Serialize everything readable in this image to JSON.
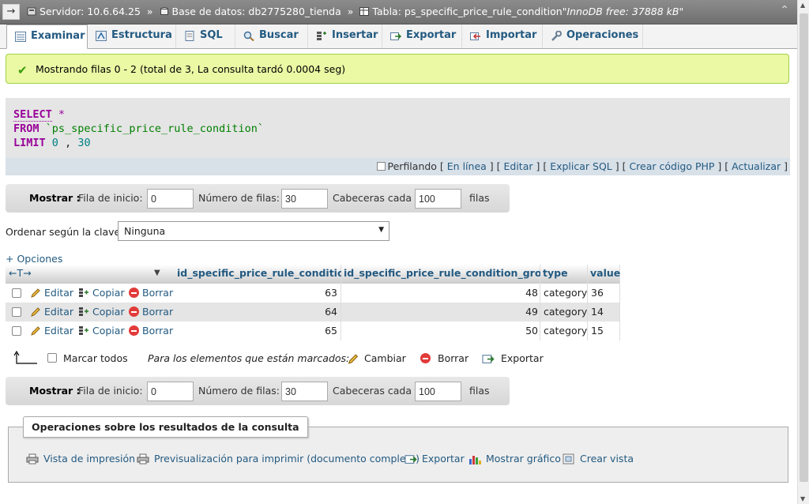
{
  "breadcrumb": {
    "server_label": "Servidor: 10.6.64.25",
    "db_label": "Base de datos: db2775280_tienda",
    "table_label": "Tabla: ps_specific_price_rule_condition",
    "table_comment": "\"InnoDB free: 37888 kB\"",
    "separator": "»"
  },
  "tabs": [
    {
      "label": "Examinar",
      "icon": "browse-icon",
      "active": true
    },
    {
      "label": "Estructura",
      "icon": "structure-icon"
    },
    {
      "label": "SQL",
      "icon": "sql-icon"
    },
    {
      "label": "Buscar",
      "icon": "search-icon"
    },
    {
      "label": "Insertar",
      "icon": "insert-icon"
    },
    {
      "label": "Exportar",
      "icon": "export-icon"
    },
    {
      "label": "Importar",
      "icon": "import-icon"
    },
    {
      "label": "Operaciones",
      "icon": "wrench-icon"
    }
  ],
  "success": {
    "message": "Mostrando filas 0 - 2 (total de 3, La consulta tardó 0.0004 seg)"
  },
  "sql": {
    "select_kw": "SELECT",
    "star": "*",
    "from_kw": "FROM",
    "table": "`ps_specific_price_rule_condition`",
    "limit_kw": "LIMIT",
    "limit_start": "0",
    "comma": ",",
    "limit_count": "30"
  },
  "sql_links": {
    "profiling": "Perfilando",
    "inline": "En línea",
    "edit": "Editar",
    "explain": "Explicar SQL",
    "create_php": "Crear código PHP",
    "refresh": "Actualizar"
  },
  "nav": {
    "show_label": "Mostrar :",
    "start_label": "Fila de inicio:",
    "start_value": "0",
    "rows_label": "Número de filas:",
    "rows_value": "30",
    "headers_label": "Cabeceras cada",
    "headers_value": "100",
    "rows_suffix": "filas"
  },
  "sort": {
    "label": "Ordenar según la clave:",
    "value": "Ninguna"
  },
  "options_link": "+ Opciones",
  "table": {
    "columns": [
      "id_specific_price_rule_condition",
      "id_specific_price_rule_condition_group",
      "type",
      "value"
    ],
    "row_actions": {
      "edit": "Editar",
      "copy": "Copiar",
      "delete": "Borrar"
    },
    "rows": [
      {
        "id": "63",
        "group": "48",
        "type": "category",
        "value": "36"
      },
      {
        "id": "64",
        "group": "49",
        "type": "category",
        "value": "14"
      },
      {
        "id": "65",
        "group": "50",
        "type": "category",
        "value": "15"
      }
    ]
  },
  "bulk": {
    "check_all": "Marcar todos",
    "with_selected": "Para los elementos que están marcados:",
    "change": "Cambiar",
    "delete": "Borrar",
    "export": "Exportar"
  },
  "operations": {
    "legend": "Operaciones sobre los resultados de la consulta",
    "print_view": "Vista de impresión",
    "print_full": "Previsualización para imprimir (documento completo)",
    "export": "Exportar",
    "chart": "Mostrar gráfico",
    "create_view": "Crear vista"
  },
  "colors": {
    "link": "#235a81",
    "keyword": "#990099",
    "success_bg": "#ebf8a4"
  }
}
